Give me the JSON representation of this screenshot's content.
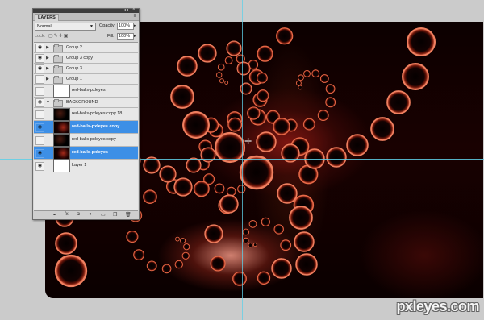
{
  "panel": {
    "tab_label": "LAYERS",
    "menu_icon": "panel-menu-icon",
    "blend_mode": "Normal",
    "opacity_label": "Opacity:",
    "opacity_value": "100%",
    "lock_label": "Lock:",
    "fill_label": "Fill:",
    "fill_value": "100%"
  },
  "layers": [
    {
      "name": "Group 2",
      "kind": "group",
      "visible": true,
      "expanded": false,
      "selected": false
    },
    {
      "name": "Group 3 copy",
      "kind": "group",
      "visible": true,
      "expanded": false,
      "selected": false
    },
    {
      "name": "Group 3",
      "kind": "group",
      "visible": true,
      "expanded": false,
      "selected": false
    },
    {
      "name": "Group 1",
      "kind": "group",
      "visible": false,
      "expanded": false,
      "selected": false
    },
    {
      "name": "red-balls-pxleyes",
      "kind": "layer",
      "visible": false,
      "selected": false
    },
    {
      "name": "BACKGROUND",
      "kind": "group",
      "visible": true,
      "expanded": true,
      "selected": false
    },
    {
      "name": "red-balls-pxleyes copy 18",
      "kind": "layer",
      "visible": false,
      "selected": false
    },
    {
      "name": "red-balls-pxleyes copy ...",
      "kind": "layer",
      "visible": true,
      "selected": true
    },
    {
      "name": "red-balls-pxleyes copy",
      "kind": "layer",
      "visible": false,
      "selected": false
    },
    {
      "name": "red-balls-pxleyes",
      "kind": "layer",
      "visible": true,
      "selected": true
    },
    {
      "name": "Layer 1",
      "kind": "layer",
      "visible": true,
      "selected": false
    }
  ],
  "bottom_icons": [
    "link-icon",
    "fx-icon",
    "mask-icon",
    "adjustment-icon",
    "new-group-icon",
    "new-layer-icon",
    "trash-icon"
  ],
  "watermark": "pxleyes.com",
  "colors": {
    "selection": "#3d8fe6",
    "guide": "#5fd0e8",
    "ring": "#c8402a"
  }
}
